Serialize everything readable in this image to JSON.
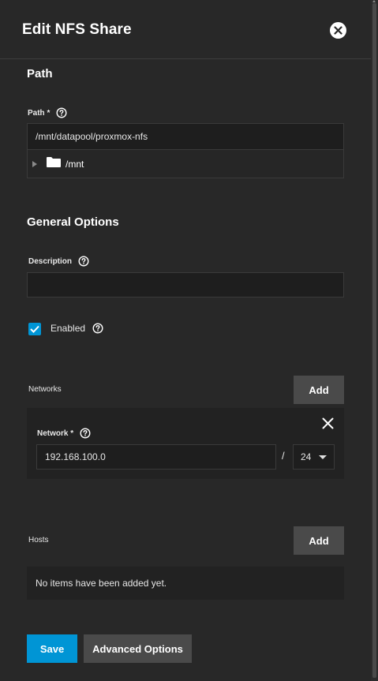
{
  "dialog": {
    "title": "Edit NFS Share"
  },
  "path_section": {
    "title": "Path",
    "path_label": "Path *",
    "path_value": "/mnt/datapool/proxmox-nfs",
    "tree_root": "/mnt"
  },
  "general_section": {
    "title": "General Options",
    "description_label": "Description",
    "description_value": "",
    "enabled_label": "Enabled",
    "enabled_checked": true
  },
  "networks": {
    "label": "Networks",
    "add_label": "Add",
    "items": [
      {
        "network_label": "Network *",
        "address": "192.168.100.0",
        "separator": "/",
        "netmask": "24"
      }
    ]
  },
  "hosts": {
    "label": "Hosts",
    "add_label": "Add",
    "empty_text": "No items have been added yet."
  },
  "actions": {
    "save_label": "Save",
    "advanced_label": "Advanced Options"
  },
  "colors": {
    "primary": "#0095d5",
    "background": "#282828",
    "input_bg": "#1e1e1e",
    "button_gray": "#4a4a4a"
  }
}
